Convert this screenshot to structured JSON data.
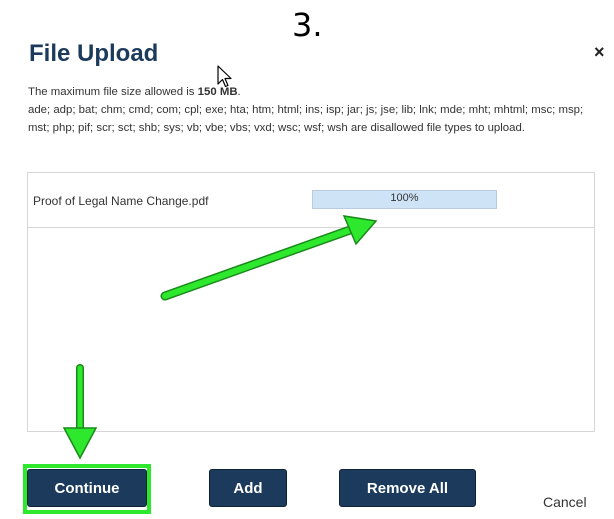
{
  "step_label": "3.",
  "dialog": {
    "title": "File Upload",
    "close_icon": "×",
    "max_size_prefix": "The maximum file size allowed is ",
    "max_size_value": "150 MB",
    "max_size_suffix": ".",
    "disallowed_text": "ade; adp; bat; chm; cmd; com; cpl; exe; hta; htm; html; ins; isp; jar; js; jse; lib; lnk; mde; mht; mhtml; msc; msp; mst; php; pif; scr; sct; shb; sys; vb; vbe; vbs; vxd; wsc; wsf; wsh are disallowed file types to upload."
  },
  "files": [
    {
      "name": "Proof of Legal Name Change.pdf",
      "progress_label": "100%",
      "progress": 1.0
    }
  ],
  "buttons": {
    "continue": "Continue",
    "add": "Add",
    "remove_all": "Remove All",
    "cancel": "Cancel"
  },
  "colors": {
    "primary_button": "#1b3a5c",
    "annotation_green": "#2ee82e",
    "progress_fill": "#cfe3f7"
  },
  "icons": {
    "close": "close-icon",
    "cursor": "mouse-cursor-icon"
  }
}
